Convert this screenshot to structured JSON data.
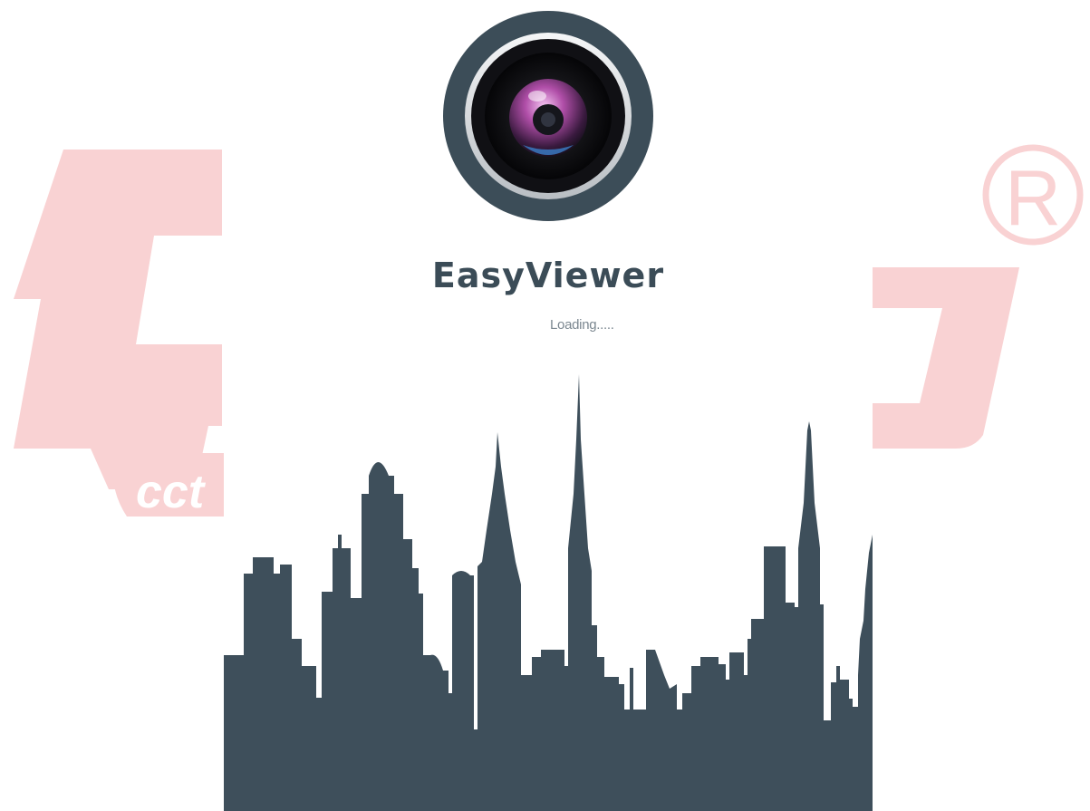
{
  "app": {
    "name": "EasyViewer",
    "status": "Loading....."
  },
  "watermark": {
    "text": "cct",
    "registered_symbol": "®",
    "color": "#f9d2d3"
  },
  "colors": {
    "skyline": "#3e4f5b",
    "title": "#3b4c57"
  },
  "icons": {
    "app_icon": "camera-lens-icon"
  }
}
